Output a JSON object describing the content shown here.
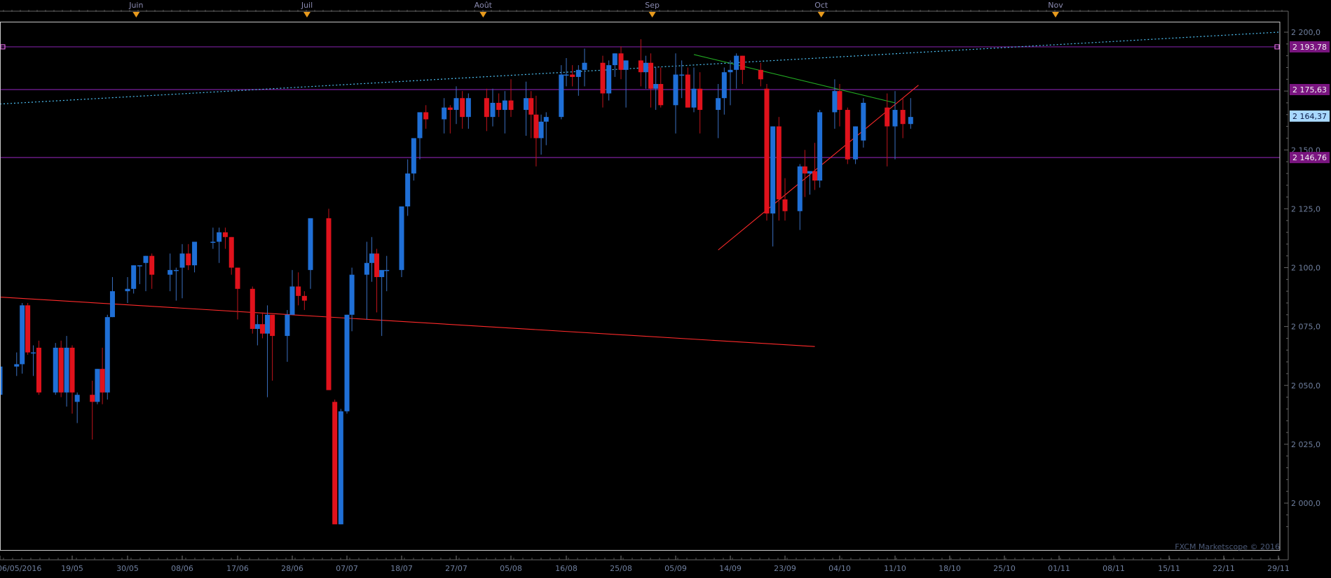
{
  "watermark": "FXCM Marketscope © 2016",
  "colors": {
    "background": "#000000",
    "frame": "#c8c8c8",
    "bull": "#1f6fd6",
    "bear": "#e0121c",
    "wick_bull": "#3a6fc0",
    "wick_bear": "#c0141c",
    "level_line": "#7a1f9c",
    "level_label_bg": "#7a1580",
    "current_label_bg": "#a8d8ff",
    "trend_red": "#ff2a2a",
    "trend_green": "#22aa22",
    "trend_dotted": "#4fc3f7",
    "month_marker": "#e89a1c"
  },
  "chart_data": {
    "type": "candlestick",
    "title": "",
    "xlabel": "",
    "ylabel": "",
    "ylim": [
      1985,
      2204
    ],
    "xlim_date": [
      "2016-05-06",
      "2016-11-29"
    ],
    "y_ticks": [
      "2 200,0",
      "2 175,0",
      "2 150,0",
      "2 125,0",
      "2 100,0",
      "2 075,0",
      "2 050,0",
      "2 025,0",
      "2 000,0"
    ],
    "y_tick_values": [
      2200,
      2175,
      2150,
      2125,
      2100,
      2075,
      2050,
      2025,
      2000
    ],
    "x_ticks": [
      "06/05/2016",
      "19/05",
      "30/05",
      "08/06",
      "17/06",
      "28/06",
      "07/07",
      "18/07",
      "27/07",
      "05/08",
      "16/08",
      "25/08",
      "05/09",
      "14/09",
      "23/09",
      "04/10",
      "11/10",
      "18/10",
      "25/10",
      "01/11",
      "08/11",
      "15/11",
      "22/11",
      "29/11"
    ],
    "x_tick_dates": [
      "2016-05-06",
      "2016-05-19",
      "2016-05-30",
      "2016-06-08",
      "2016-06-17",
      "2016-06-28",
      "2016-07-07",
      "2016-07-18",
      "2016-07-27",
      "2016-08-05",
      "2016-08-16",
      "2016-08-25",
      "2016-09-05",
      "2016-09-14",
      "2016-09-23",
      "2016-10-04",
      "2016-10-11",
      "2016-10-18",
      "2016-10-25",
      "2016-11-01",
      "2016-11-08",
      "2016-11-15",
      "2016-11-22",
      "2016-11-29"
    ],
    "month_markers": [
      {
        "label": "Juin",
        "date": "2016-06-01"
      },
      {
        "label": "Juil",
        "date": "2016-07-01"
      },
      {
        "label": "Août",
        "date": "2016-08-01"
      },
      {
        "label": "Sep",
        "date": "2016-09-01"
      },
      {
        "label": "Oct",
        "date": "2016-10-01"
      },
      {
        "label": "Nov",
        "date": "2016-11-01"
      }
    ],
    "horizontal_levels": [
      {
        "value": 2193.78,
        "label": "2 193,78"
      },
      {
        "value": 2175.63,
        "label": "2 175,63"
      },
      {
        "value": 2146.76,
        "label": "2 146,76"
      }
    ],
    "current_price": {
      "value": 2164.37,
      "label": "2 164,37"
    },
    "trendlines": [
      {
        "name": "support-red",
        "style": "solid",
        "color": "#ff2a2a",
        "from": [
          "2016-09-12",
          2107.5
        ],
        "to": [
          "2016-10-14",
          2177.5
        ]
      },
      {
        "name": "long-red",
        "style": "solid",
        "color": "#ff2a2a",
        "from": [
          "2016-05-06",
          2087.5
        ],
        "to": [
          "2016-09-29",
          2066.5
        ]
      },
      {
        "name": "resistance-green",
        "style": "solid",
        "color": "#22aa22",
        "from": [
          "2016-09-08",
          2190.5
        ],
        "to": [
          "2016-10-11",
          2170.0
        ]
      },
      {
        "name": "dotted-upper",
        "style": "dotted",
        "color": "#4fc3f7",
        "from": [
          "2016-05-06",
          2169.5
        ],
        "to": [
          "2016-11-29",
          2200.0
        ]
      }
    ],
    "candles": [
      {
        "d": "2016-05-06",
        "o": 2046,
        "h": 2058,
        "l": 2039,
        "c": 2058
      },
      {
        "d": "2016-05-09",
        "o": 2058,
        "h": 2064,
        "l": 2054,
        "c": 2059
      },
      {
        "d": "2016-05-10",
        "o": 2059,
        "h": 2085,
        "l": 2055,
        "c": 2084
      },
      {
        "d": "2016-05-11",
        "o": 2084,
        "h": 2085,
        "l": 2063,
        "c": 2064
      },
      {
        "d": "2016-05-12",
        "o": 2064,
        "h": 2067,
        "l": 2054,
        "c": 2064
      },
      {
        "d": "2016-05-13",
        "o": 2066,
        "h": 2069,
        "l": 2046,
        "c": 2047
      },
      {
        "d": "2016-05-16",
        "o": 2047,
        "h": 2068,
        "l": 2046,
        "c": 2066
      },
      {
        "d": "2016-05-17",
        "o": 2066,
        "h": 2069,
        "l": 2045,
        "c": 2047
      },
      {
        "d": "2016-05-18",
        "o": 2047,
        "h": 2071,
        "l": 2041,
        "c": 2066
      },
      {
        "d": "2016-05-19",
        "o": 2066,
        "h": 2067,
        "l": 2038,
        "c": 2047
      },
      {
        "d": "2016-05-20",
        "o": 2043,
        "h": 2047,
        "l": 2034,
        "c": 2046
      },
      {
        "d": "2016-05-23",
        "o": 2046,
        "h": 2052,
        "l": 2027,
        "c": 2043
      },
      {
        "d": "2016-05-24",
        "o": 2043,
        "h": 2057,
        "l": 2042,
        "c": 2057
      },
      {
        "d": "2016-05-25",
        "o": 2057,
        "h": 2066,
        "l": 2042,
        "c": 2047
      },
      {
        "d": "2016-05-26",
        "o": 2047,
        "h": 2080,
        "l": 2044,
        "c": 2079
      },
      {
        "d": "2016-05-27",
        "o": 2079,
        "h": 2096,
        "l": 2079,
        "c": 2090
      },
      {
        "d": "2016-05-30",
        "o": 2090,
        "h": 2096,
        "l": 2085,
        "c": 2091
      },
      {
        "d": "2016-05-31",
        "o": 2091,
        "h": 2101,
        "l": 2089,
        "c": 2101
      },
      {
        "d": "2016-06-01",
        "o": 2101,
        "h": 2101,
        "l": 2093,
        "c": 2101
      },
      {
        "d": "2016-06-02",
        "o": 2102,
        "h": 2105,
        "l": 2090,
        "c": 2105
      },
      {
        "d": "2016-06-03",
        "o": 2105,
        "h": 2106,
        "l": 2091,
        "c": 2097
      },
      {
        "d": "2016-06-06",
        "o": 2097,
        "h": 2106,
        "l": 2090,
        "c": 2099
      },
      {
        "d": "2016-06-07",
        "o": 2099,
        "h": 2100,
        "l": 2086,
        "c": 2099
      },
      {
        "d": "2016-06-08",
        "o": 2100,
        "h": 2110,
        "l": 2087,
        "c": 2106
      },
      {
        "d": "2016-06-09",
        "o": 2106,
        "h": 2110,
        "l": 2099,
        "c": 2101
      },
      {
        "d": "2016-06-10",
        "o": 2101,
        "h": 2110,
        "l": 2098,
        "c": 2111
      },
      {
        "d": "2016-06-13",
        "o": 2111,
        "h": 2117,
        "l": 2108,
        "c": 2111
      },
      {
        "d": "2016-06-14",
        "o": 2111,
        "h": 2117,
        "l": 2102,
        "c": 2115
      },
      {
        "d": "2016-06-15",
        "o": 2115,
        "h": 2117,
        "l": 2108,
        "c": 2113
      },
      {
        "d": "2016-06-16",
        "o": 2113,
        "h": 2113,
        "l": 2097,
        "c": 2100
      },
      {
        "d": "2016-06-17",
        "o": 2100,
        "h": 2100,
        "l": 2078,
        "c": 2091
      },
      {
        "d": "2016-06-20",
        "o": 2091,
        "h": 2092,
        "l": 2072,
        "c": 2074
      },
      {
        "d": "2016-06-21",
        "o": 2074,
        "h": 2080,
        "l": 2067,
        "c": 2076
      },
      {
        "d": "2016-06-22",
        "o": 2076,
        "h": 2081,
        "l": 2070,
        "c": 2072
      },
      {
        "d": "2016-06-23",
        "o": 2072,
        "h": 2084,
        "l": 2045,
        "c": 2080
      },
      {
        "d": "2016-06-24",
        "o": 2080,
        "h": 2080,
        "l": 2052,
        "c": 2071
      },
      {
        "d": "2016-06-27",
        "o": 2071,
        "h": 2082,
        "l": 2060,
        "c": 2080
      },
      {
        "d": "2016-06-28",
        "o": 2080,
        "h": 2099,
        "l": 2080,
        "c": 2092
      },
      {
        "d": "2016-06-29",
        "o": 2092,
        "h": 2098,
        "l": 2084,
        "c": 2088
      },
      {
        "d": "2016-06-30",
        "o": 2088,
        "h": 2090,
        "l": 2082,
        "c": 2086
      },
      {
        "d": "2016-07-01",
        "o": 2099,
        "h": 2121,
        "l": 2091,
        "c": 2121
      },
      {
        "d": "2016-07-04",
        "o": 2121,
        "h": 2125,
        "l": 2048,
        "c": 2048
      },
      {
        "d": "2016-07-05",
        "o": 2043,
        "h": 2044,
        "l": 2005,
        "c": 1991
      },
      {
        "d": "2016-07-06",
        "o": 1991,
        "h": 2040,
        "l": 1991,
        "c": 2039
      },
      {
        "d": "2016-07-07",
        "o": 2039,
        "h": 2080,
        "l": 2038,
        "c": 2080
      },
      {
        "d": "2016-07-08",
        "o": 2080,
        "h": 2100,
        "l": 2073,
        "c": 2097
      },
      {
        "d": "2016-07-11",
        "o": 2097,
        "h": 2111,
        "l": 2078,
        "c": 2102
      },
      {
        "d": "2016-07-12",
        "o": 2102,
        "h": 2113,
        "l": 2094,
        "c": 2106
      },
      {
        "d": "2016-07-13",
        "o": 2106,
        "h": 2108,
        "l": 2081,
        "c": 2096
      },
      {
        "d": "2016-07-14",
        "o": 2096,
        "h": 2097,
        "l": 2071,
        "c": 2099
      },
      {
        "d": "2016-07-15",
        "o": 2099,
        "h": 2105,
        "l": 2090,
        "c": 2099
      },
      {
        "d": "2016-07-18",
        "o": 2099,
        "h": 2126,
        "l": 2096,
        "c": 2126
      },
      {
        "d": "2016-07-19",
        "o": 2126,
        "h": 2146,
        "l": 2122,
        "c": 2140
      },
      {
        "d": "2016-07-20",
        "o": 2140,
        "h": 2151,
        "l": 2137,
        "c": 2155
      },
      {
        "d": "2016-07-21",
        "o": 2155,
        "h": 2163,
        "l": 2146,
        "c": 2166
      },
      {
        "d": "2016-07-22",
        "o": 2166,
        "h": 2169,
        "l": 2159,
        "c": 2163
      },
      {
        "d": "2016-07-25",
        "o": 2163,
        "h": 2172,
        "l": 2157,
        "c": 2168
      },
      {
        "d": "2016-07-26",
        "o": 2168,
        "h": 2169,
        "l": 2157,
        "c": 2167
      },
      {
        "d": "2016-07-27",
        "o": 2167,
        "h": 2177,
        "l": 2161,
        "c": 2172
      },
      {
        "d": "2016-07-28",
        "o": 2172,
        "h": 2175,
        "l": 2159,
        "c": 2164
      },
      {
        "d": "2016-07-29",
        "o": 2164,
        "h": 2174,
        "l": 2159,
        "c": 2172
      },
      {
        "d": "2016-08-01",
        "o": 2172,
        "h": 2176,
        "l": 2158,
        "c": 2164
      },
      {
        "d": "2016-08-02",
        "o": 2164,
        "h": 2176,
        "l": 2160,
        "c": 2170
      },
      {
        "d": "2016-08-03",
        "o": 2170,
        "h": 2174,
        "l": 2164,
        "c": 2167
      },
      {
        "d": "2016-08-04",
        "o": 2167,
        "h": 2175,
        "l": 2157,
        "c": 2171
      },
      {
        "d": "2016-08-05",
        "o": 2171,
        "h": 2180,
        "l": 2164,
        "c": 2167
      },
      {
        "d": "2016-08-08",
        "o": 2167,
        "h": 2179,
        "l": 2156,
        "c": 2172
      },
      {
        "d": "2016-08-09",
        "o": 2172,
        "h": 2175,
        "l": 2155,
        "c": 2165
      },
      {
        "d": "2016-08-10",
        "o": 2165,
        "h": 2173,
        "l": 2143,
        "c": 2155
      },
      {
        "d": "2016-08-11",
        "o": 2155,
        "h": 2165,
        "l": 2148,
        "c": 2162
      },
      {
        "d": "2016-08-12",
        "o": 2162,
        "h": 2166,
        "l": 2152,
        "c": 2164
      },
      {
        "d": "2016-08-15",
        "o": 2164,
        "h": 2186,
        "l": 2163,
        "c": 2182
      },
      {
        "d": "2016-08-16",
        "o": 2182,
        "h": 2189,
        "l": 2177,
        "c": 2182
      },
      {
        "d": "2016-08-17",
        "o": 2182,
        "h": 2186,
        "l": 2177,
        "c": 2181
      },
      {
        "d": "2016-08-18",
        "o": 2181,
        "h": 2186,
        "l": 2173,
        "c": 2184
      },
      {
        "d": "2016-08-19",
        "o": 2184,
        "h": 2193,
        "l": 2177,
        "c": 2187
      },
      {
        "d": "2016-08-22",
        "o": 2187,
        "h": 2190,
        "l": 2168,
        "c": 2174
      },
      {
        "d": "2016-08-23",
        "o": 2174,
        "h": 2188,
        "l": 2171,
        "c": 2186
      },
      {
        "d": "2016-08-24",
        "o": 2186,
        "h": 2191,
        "l": 2181,
        "c": 2191
      },
      {
        "d": "2016-08-25",
        "o": 2191,
        "h": 2194,
        "l": 2180,
        "c": 2184
      },
      {
        "d": "2016-08-26",
        "o": 2184,
        "h": 2188,
        "l": 2168,
        "c": 2188
      },
      {
        "d": "2016-08-29",
        "o": 2188,
        "h": 2197,
        "l": 2177,
        "c": 2183
      },
      {
        "d": "2016-08-30",
        "o": 2183,
        "h": 2190,
        "l": 2176,
        "c": 2187
      },
      {
        "d": "2016-08-31",
        "o": 2187,
        "h": 2191,
        "l": 2168,
        "c": 2176
      },
      {
        "d": "2016-09-01",
        "o": 2176,
        "h": 2185,
        "l": 2167,
        "c": 2178
      },
      {
        "d": "2016-09-02",
        "o": 2178,
        "h": 2185,
        "l": 2168,
        "c": 2169
      },
      {
        "d": "2016-09-05",
        "o": 2169,
        "h": 2191,
        "l": 2157,
        "c": 2182
      },
      {
        "d": "2016-09-06",
        "o": 2182,
        "h": 2188,
        "l": 2172,
        "c": 2182
      },
      {
        "d": "2016-09-07",
        "o": 2182,
        "h": 2185,
        "l": 2168,
        "c": 2168
      },
      {
        "d": "2016-09-08",
        "o": 2168,
        "h": 2185,
        "l": 2166,
        "c": 2176
      },
      {
        "d": "2016-09-09",
        "o": 2176,
        "h": 2183,
        "l": 2157,
        "c": 2167
      },
      {
        "d": "2016-09-12",
        "o": 2167,
        "h": 2178,
        "l": 2155,
        "c": 2172
      },
      {
        "d": "2016-09-13",
        "o": 2172,
        "h": 2185,
        "l": 2165,
        "c": 2183
      },
      {
        "d": "2016-09-14",
        "o": 2183,
        "h": 2188,
        "l": 2169,
        "c": 2184
      },
      {
        "d": "2016-09-15",
        "o": 2184,
        "h": 2191,
        "l": 2176,
        "c": 2190
      },
      {
        "d": "2016-09-16",
        "o": 2190,
        "h": 2190,
        "l": 2178,
        "c": 2184
      },
      {
        "d": "2016-09-19",
        "o": 2184,
        "h": 2187,
        "l": 2177,
        "c": 2180
      },
      {
        "d": "2016-09-20",
        "o": 2176,
        "h": 2178,
        "l": 2120,
        "c": 2123
      },
      {
        "d": "2016-09-21",
        "o": 2123,
        "h": 2160,
        "l": 2109,
        "c": 2160
      },
      {
        "d": "2016-09-22",
        "o": 2160,
        "h": 2164,
        "l": 2120,
        "c": 2129
      },
      {
        "d": "2016-09-23",
        "o": 2129,
        "h": 2138,
        "l": 2120,
        "c": 2124
      },
      {
        "d": "2016-09-26",
        "o": 2124,
        "h": 2144,
        "l": 2116,
        "c": 2143
      },
      {
        "d": "2016-09-27",
        "o": 2143,
        "h": 2150,
        "l": 2130,
        "c": 2140
      },
      {
        "d": "2016-09-28",
        "o": 2140,
        "h": 2141,
        "l": 2131,
        "c": 2141
      },
      {
        "d": "2016-09-29",
        "o": 2141,
        "h": 2153,
        "l": 2133,
        "c": 2137
      },
      {
        "d": "2016-09-30",
        "o": 2137,
        "h": 2167,
        "l": 2134,
        "c": 2166
      },
      {
        "d": "2016-10-03",
        "o": 2166,
        "h": 2180,
        "l": 2159,
        "c": 2175
      },
      {
        "d": "2016-10-04",
        "o": 2175,
        "h": 2178,
        "l": 2160,
        "c": 2167
      },
      {
        "d": "2016-10-05",
        "o": 2167,
        "h": 2168,
        "l": 2144,
        "c": 2146
      },
      {
        "d": "2016-10-06",
        "o": 2146,
        "h": 2160,
        "l": 2144,
        "c": 2160
      },
      {
        "d": "2016-10-07",
        "o": 2154,
        "h": 2172,
        "l": 2151,
        "c": 2170
      },
      {
        "d": "2016-10-10",
        "o": 2168,
        "h": 2174,
        "l": 2143,
        "c": 2160
      },
      {
        "d": "2016-10-11",
        "o": 2160,
        "h": 2175,
        "l": 2146,
        "c": 2167
      },
      {
        "d": "2016-10-12",
        "o": 2167,
        "h": 2172,
        "l": 2155,
        "c": 2161
      },
      {
        "d": "2016-10-13",
        "o": 2161,
        "h": 2172,
        "l": 2159,
        "c": 2164
      }
    ]
  }
}
